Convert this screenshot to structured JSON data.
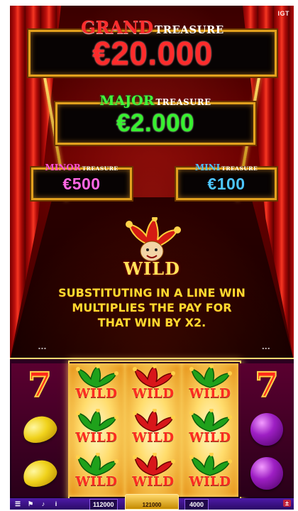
{
  "brand": {
    "logo_text": "IGT"
  },
  "jackpots": {
    "grand": {
      "tier": "GRAND",
      "treasure": "TREASURE",
      "value": "€20.000",
      "color": "#ff2b2b"
    },
    "major": {
      "tier": "MAJOR",
      "treasure": "TREASURE",
      "value": "€2.000",
      "color": "#37f12f"
    },
    "minor": {
      "tier": "MINOR",
      "treasure": "TREASURE",
      "value": "€500",
      "color": "#ff66e2"
    },
    "mini": {
      "tier": "MINI",
      "treasure": "TREASURE",
      "value": "€100",
      "color": "#4dc6ff"
    }
  },
  "feature": {
    "symbol_label": "WILD",
    "description": "SUBSTITUTING IN A LINE WIN\nMULTIPLIES THE PAY FOR\nTHAT WIN BY X2."
  },
  "reels": {
    "reel_1": [
      "seven",
      "lemon",
      "lemon"
    ],
    "reel_2": [
      "wild",
      "wild",
      "wild"
    ],
    "reel_3": [
      "wild",
      "wild",
      "wild"
    ],
    "reel_4": [
      "wild",
      "wild",
      "wild"
    ],
    "reel_5": [
      "seven",
      "plum",
      "plum"
    ],
    "seven_label": "7",
    "wild_label": "WILD"
  },
  "bottom_bar": {
    "credit": "112000",
    "win": "121000",
    "bet": "4000",
    "menu_icon": "menu-icon",
    "flag_icon": "flag-icon",
    "sound_icon": "sound-icon",
    "info_icon": "info-icon"
  }
}
